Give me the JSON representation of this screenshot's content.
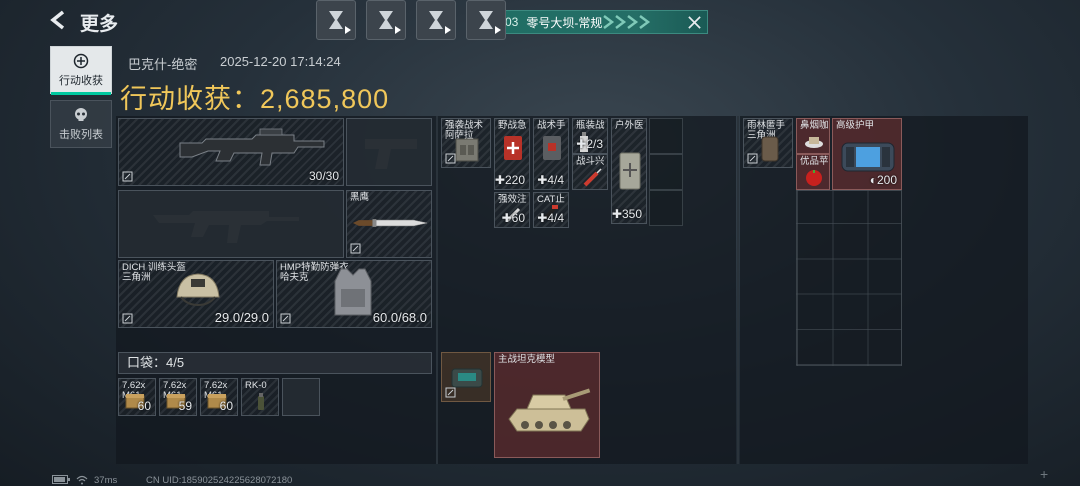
{
  "header": {
    "back_label": "更多"
  },
  "banner": {
    "index": "03",
    "map": "零号大坝-常规"
  },
  "tabs": [
    {
      "label": "行动收获",
      "active": true
    },
    {
      "label": "击败列表",
      "active": false
    }
  ],
  "info": {
    "operator": "巴克什-绝密",
    "datetime": "2025-12-20 17:14:24",
    "haul_label": "行动收获：",
    "haul_value": "2,685,800"
  },
  "loadout": {
    "primary_ammo": "30/30",
    "melee_name": "黑鹰",
    "helmet": {
      "name": "DICH 训练头盔",
      "sub": "三角洲",
      "durability": "29.0/29.0"
    },
    "vest": {
      "name": "HMP特勤防弹衣",
      "sub": "哈夫克",
      "durability": "60.0/68.0"
    }
  },
  "pocket": {
    "label": "口袋：4/5",
    "items": [
      {
        "name": "7.62x",
        "sub": "M61",
        "qty": "60"
      },
      {
        "name": "7.62x",
        "sub": "M61",
        "qty": "59"
      },
      {
        "name": "7.62x",
        "sub": "M61",
        "qty": "60"
      },
      {
        "name": "RK-0",
        "sub": "",
        "qty": ""
      }
    ]
  },
  "rig_items": [
    {
      "name": "强袭战术",
      "sub": "阿萨拉",
      "qty": ""
    },
    {
      "name": "野战急",
      "qty": "220"
    },
    {
      "name": "战术手",
      "qty": "4/4"
    },
    {
      "name": "瓶装战",
      "qty": "2/3"
    },
    {
      "name": "战斗兴",
      "qty": ""
    },
    {
      "name": "户外医",
      "qty": "350"
    },
    {
      "name": "强效注",
      "qty": "60"
    },
    {
      "name": "CAT止",
      "qty": "4/4"
    }
  ],
  "backpack_items": [
    {
      "name": "主战坦克模型",
      "qty": ""
    }
  ],
  "case_items": [
    {
      "name": "雨林匿手",
      "sub": "三角洲",
      "qty": ""
    },
    {
      "name": "鼻烟咖",
      "qty": ""
    },
    {
      "name": "优品苹",
      "qty": ""
    },
    {
      "name": "高级护甲",
      "qty": "200"
    }
  ],
  "footer": {
    "ping": "37ms",
    "uid": "CN UID:1859025242256​28072180"
  },
  "colors": {
    "accent": "#00c8a0",
    "gold": "#f0c75a",
    "banner": "#1f6e64"
  }
}
